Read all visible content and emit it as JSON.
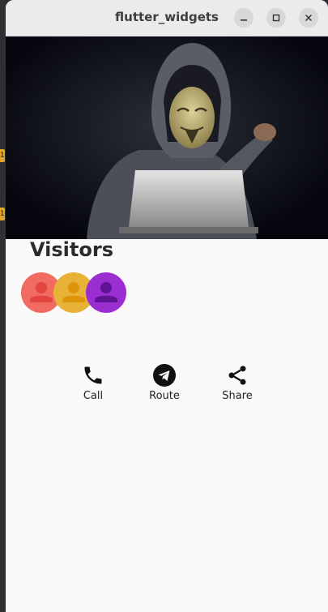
{
  "window": {
    "title": "flutter_widgets"
  },
  "header_image": {
    "description_icon": "hooded-hacker-with-mask-image"
  },
  "visitors": {
    "title": "Visitors",
    "avatars": [
      {
        "icon": "person-icon",
        "color": "#f26b63"
      },
      {
        "icon": "person-icon",
        "color": "#e8b236"
      },
      {
        "icon": "person-icon",
        "color": "#9b2ed0"
      }
    ]
  },
  "actions": [
    {
      "label": "Call",
      "icon": "phone-icon"
    },
    {
      "label": "Route",
      "icon": "telegram-send-icon"
    },
    {
      "label": "Share",
      "icon": "share-icon"
    }
  ],
  "desktop": {
    "badges": [
      "1",
      "1"
    ]
  }
}
